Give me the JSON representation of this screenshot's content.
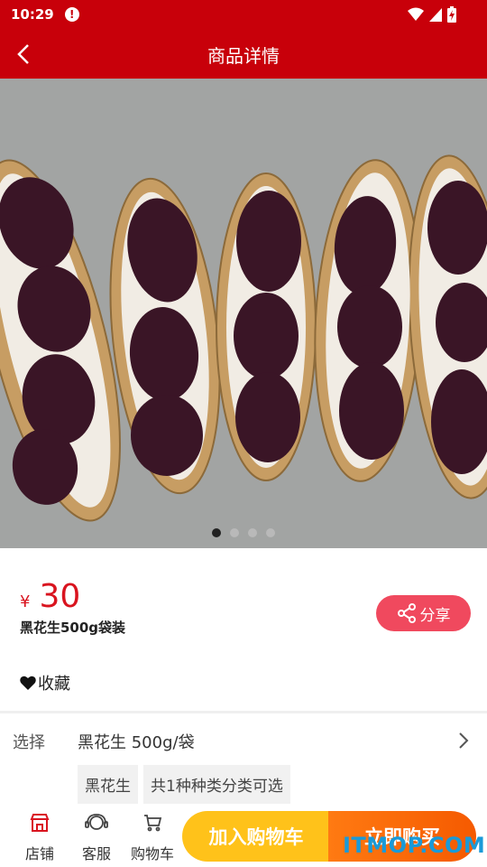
{
  "status_bar": {
    "time": "10:29",
    "alert_icon": "alert-circle-icon"
  },
  "header": {
    "title": "商品详情",
    "back_icon": "chevron-left-icon"
  },
  "gallery": {
    "image": "black-peanuts-photo",
    "dot_count": 4,
    "active_dot": 1
  },
  "product": {
    "price_symbol": "¥",
    "price": "30",
    "name": "黑花生500g袋装",
    "share_label": "分享",
    "favorite_label": "收藏"
  },
  "spec": {
    "label": "选择",
    "value": "黑花生 500g/袋",
    "chips": [
      "黑花生",
      "共1种种类分类可选"
    ]
  },
  "bottom_bar": {
    "store_label": "店铺",
    "service_label": "客服",
    "cart_label": "购物车",
    "add_cart_label": "加入购物车",
    "buy_now_label": "立即购买"
  },
  "watermark": "ITMOP.COM",
  "colors": {
    "primary": "#c8000a",
    "price": "#d9141f",
    "share": "#f0495e",
    "cart_button": "#ffc21a",
    "buy_button": "#f55a00"
  }
}
